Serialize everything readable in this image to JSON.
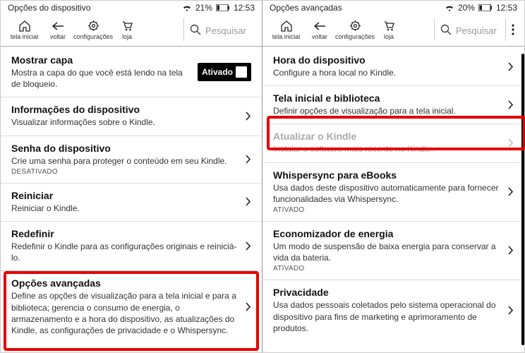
{
  "left": {
    "status": {
      "title": "Opções do dispositivo",
      "battery": "21%",
      "time": "12:53"
    },
    "toolbar": {
      "home": "tela inicial",
      "back": "voltar",
      "settings": "configurações",
      "store": "loja",
      "search_placeholder": "Pesquisar"
    },
    "items": [
      {
        "title": "Mostrar capa",
        "desc": "Mostra a capa do que você está lendo na tela de bloqueio.",
        "toggle": "Ativado"
      },
      {
        "title": "Informações do dispositivo",
        "desc": "Visualizar informações sobre o Kindle."
      },
      {
        "title": "Senha do dispositivo",
        "desc": "Crie uma senha para proteger o conteúdo em seu Kindle.",
        "sub": "DESATIVADO"
      },
      {
        "title": "Reiniciar",
        "desc": "Reiniciar o Kindle."
      },
      {
        "title": "Redefinir",
        "desc": "Redefinir o Kindle para as configurações originais e reiniciá-lo."
      },
      {
        "title": "Opções avançadas",
        "desc": "Define as opções de visualização para a tela inicial e para a biblioteca; gerencia o consumo de energia, o armazenamento e a hora do dispositivo, as atualizações do Kindle, as configurações de privacidade e o Whispersync."
      }
    ]
  },
  "right": {
    "status": {
      "title": "Opções avançadas",
      "battery": "20%",
      "time": "12:53"
    },
    "toolbar": {
      "home": "tela inicial",
      "back": "voltar",
      "settings": "configurações",
      "store": "loja",
      "search_placeholder": "Pesquisar"
    },
    "items": [
      {
        "title": "Hora do dispositivo",
        "desc": "Configure a hora local no Kindle."
      },
      {
        "title": "Tela inicial e biblioteca",
        "desc": "Definir opções de visualização para a tela inicial."
      },
      {
        "title": "Atualizar o Kindle",
        "desc": "Instalar o software mais recente no Kindle.",
        "disabled": true
      },
      {
        "title": "Whispersync para eBooks",
        "desc": "Usa dados deste dispositivo automaticamente para fornecer funcionalidades via Whispersync.",
        "sub": "ATIVADO"
      },
      {
        "title": "Economizador de energia",
        "desc": "Um modo de suspensão de baixa energia para conservar a vida da bateria.",
        "sub": "ATIVADO"
      },
      {
        "title": "Privacidade",
        "desc": "Usa dados pessoais coletados pelo sistema operacional do dispositivo para fins de marketing e aprimoramento de produtos."
      }
    ]
  }
}
